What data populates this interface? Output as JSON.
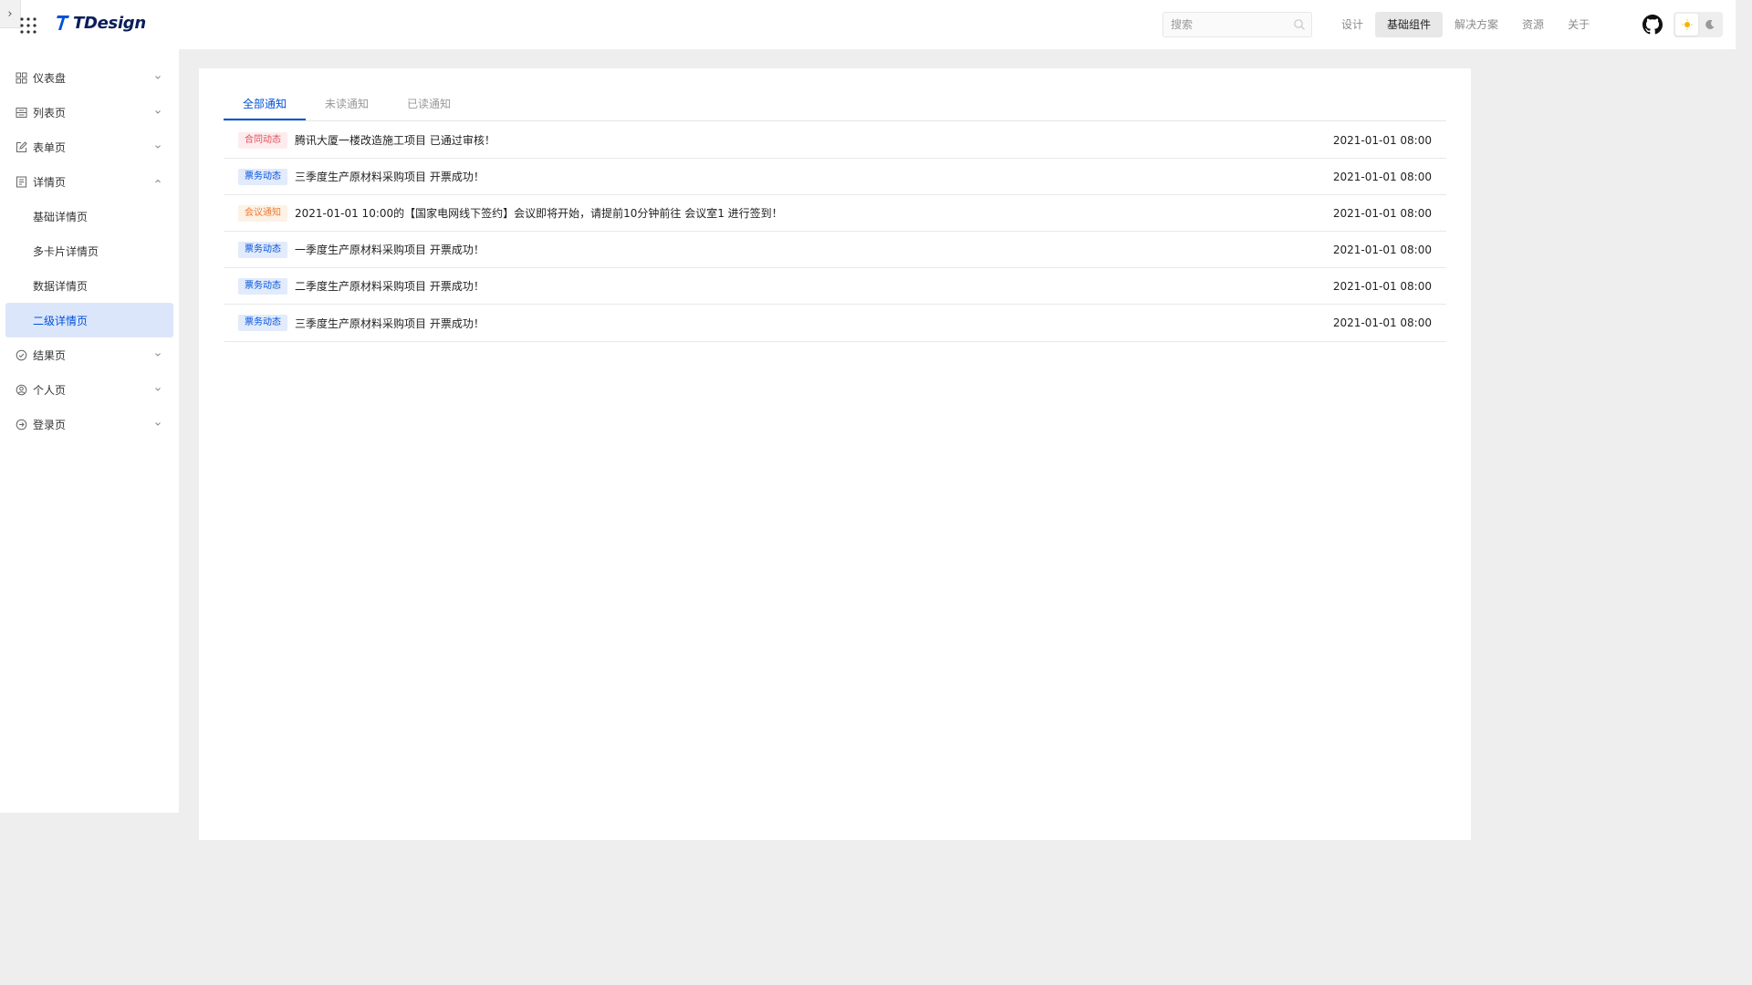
{
  "header": {
    "collapse_glyph": "›",
    "logo_text": "TDesign",
    "search": {
      "placeholder": "搜索",
      "value": ""
    },
    "nav": [
      {
        "label": "设计",
        "active": false
      },
      {
        "label": "基础组件",
        "active": true
      },
      {
        "label": "解决方案",
        "active": false
      },
      {
        "label": "资源",
        "active": false
      },
      {
        "label": "关于",
        "active": false
      }
    ],
    "theme": {
      "selected": "light"
    }
  },
  "sidebar": {
    "items": [
      {
        "label": "仪表盘",
        "icon": "dashboard-icon",
        "expanded": false
      },
      {
        "label": "列表页",
        "icon": "list-icon",
        "expanded": false
      },
      {
        "label": "表单页",
        "icon": "edit-icon",
        "expanded": false
      },
      {
        "label": "详情页",
        "icon": "detail-icon",
        "expanded": true,
        "children": [
          {
            "label": "基础详情页",
            "active": false
          },
          {
            "label": "多卡片详情页",
            "active": false
          },
          {
            "label": "数据详情页",
            "active": false
          },
          {
            "label": "二级详情页",
            "active": true
          }
        ]
      },
      {
        "label": "结果页",
        "icon": "check-circle-icon",
        "expanded": false
      },
      {
        "label": "个人页",
        "icon": "user-circle-icon",
        "expanded": false
      },
      {
        "label": "登录页",
        "icon": "login-icon",
        "expanded": false
      }
    ]
  },
  "tabs": [
    {
      "label": "全部通知",
      "active": true
    },
    {
      "label": "未读通知",
      "active": false
    },
    {
      "label": "已读通知",
      "active": false
    }
  ],
  "notifications": [
    {
      "tag": "合同动态",
      "tag_color": "#e34d59",
      "tag_bg": "#fdecee",
      "text": "腾讯大厦一楼改造施工项目 已通过审核！",
      "time": "2021-01-01 08:00"
    },
    {
      "tag": "票务动态",
      "tag_color": "#0052d9",
      "tag_bg": "#e2ebfc",
      "text": "三季度生产原材料采购项目 开票成功！",
      "time": "2021-01-01 08:00"
    },
    {
      "tag": "会议通知",
      "tag_color": "#ed7b2f",
      "tag_bg": "#fef1e6",
      "text": "2021-01-01 10:00的【国家电网线下签约】会议即将开始，请提前10分钟前往 会议室1 进行签到！",
      "time": "2021-01-01 08:00"
    },
    {
      "tag": "票务动态",
      "tag_color": "#0052d9",
      "tag_bg": "#e2ebfc",
      "text": "一季度生产原材料采购项目 开票成功！",
      "time": "2021-01-01 08:00"
    },
    {
      "tag": "票务动态",
      "tag_color": "#0052d9",
      "tag_bg": "#e2ebfc",
      "text": "二季度生产原材料采购项目 开票成功！",
      "time": "2021-01-01 08:00"
    },
    {
      "tag": "票务动态",
      "tag_color": "#0052d9",
      "tag_bg": "#e2ebfc",
      "text": "三季度生产原材料采购项目 开票成功！",
      "time": "2021-01-01 08:00"
    }
  ]
}
